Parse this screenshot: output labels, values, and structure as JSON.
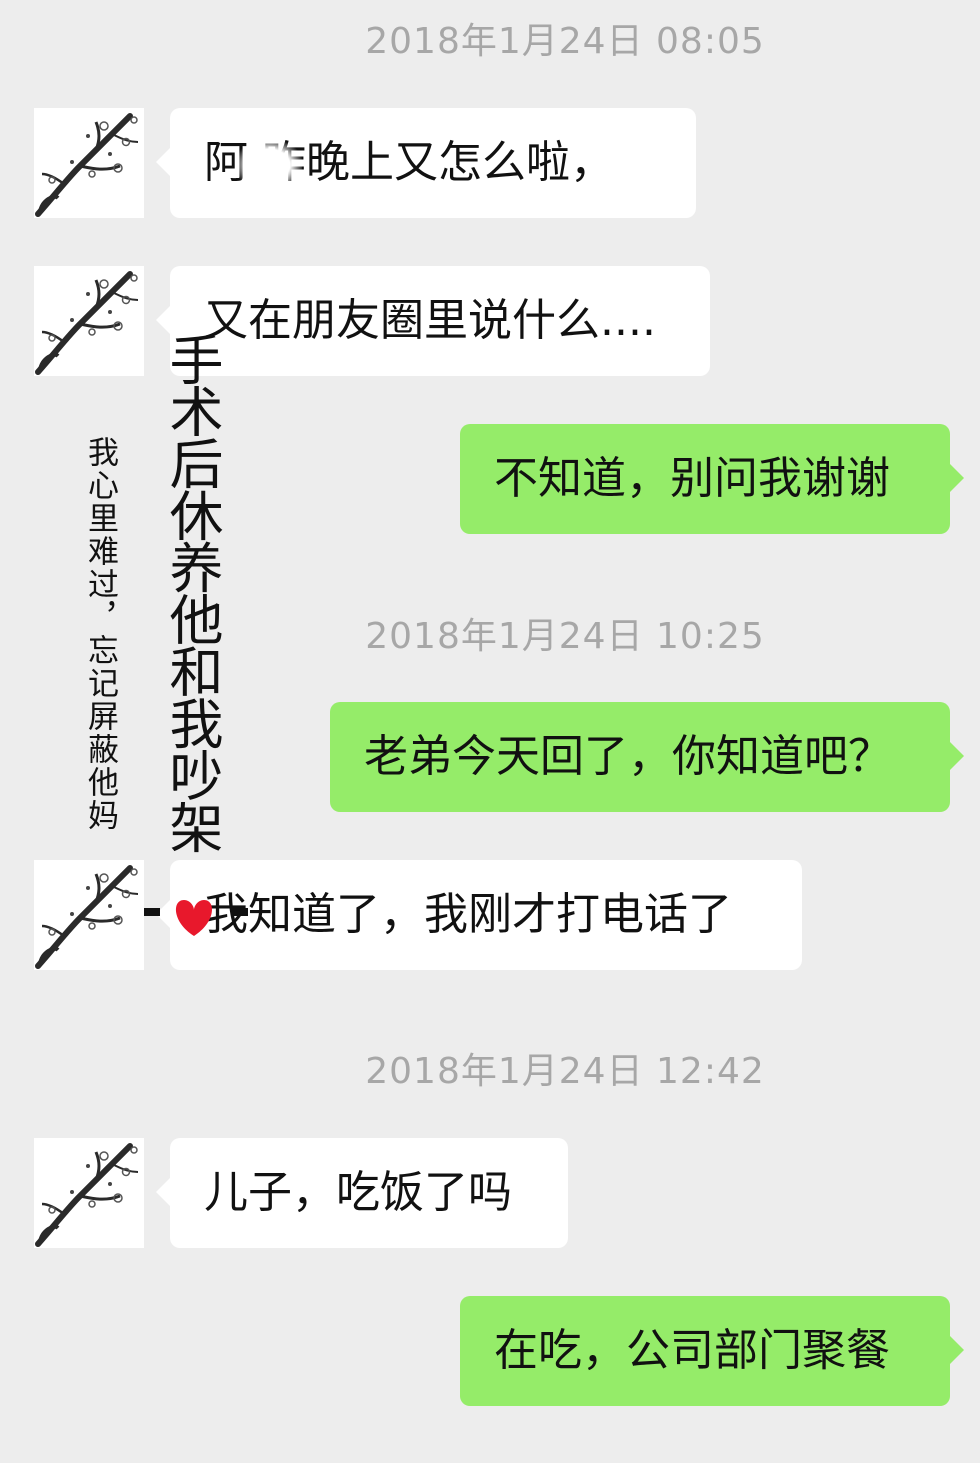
{
  "timestamps": [
    "2018年1月24日 08:05",
    "2018年1月24日 10:25",
    "2018年1月24日 12:42"
  ],
  "messages": [
    {
      "side": "received",
      "text": "阿 昨晚上又怎么啦，"
    },
    {
      "side": "received",
      "text": "又在朋友圈里说什么...."
    },
    {
      "side": "sent",
      "text": "不知道，别问我谢谢"
    },
    {
      "side": "sent",
      "text": "老弟今天回了，你知道吧？"
    },
    {
      "side": "received",
      "text": "我知道了，我刚才打电话了"
    },
    {
      "side": "received",
      "text": "儿子，吃饭了吗"
    },
    {
      "side": "sent",
      "text": "在吃，公司部门聚餐"
    }
  ],
  "annotations": {
    "large_vertical": "手术后休养他和我吵架",
    "small_vertical": "我心里难过，忘记屏蔽他妈"
  },
  "colors": {
    "background": "#ededed",
    "received_bubble": "#ffffff",
    "sent_bubble": "#95ec69",
    "timestamp_text": "#a7a7a7",
    "heart": "#e8182c"
  },
  "icons": {
    "avatar": "plum-blossom-branch",
    "mark": "heart"
  }
}
